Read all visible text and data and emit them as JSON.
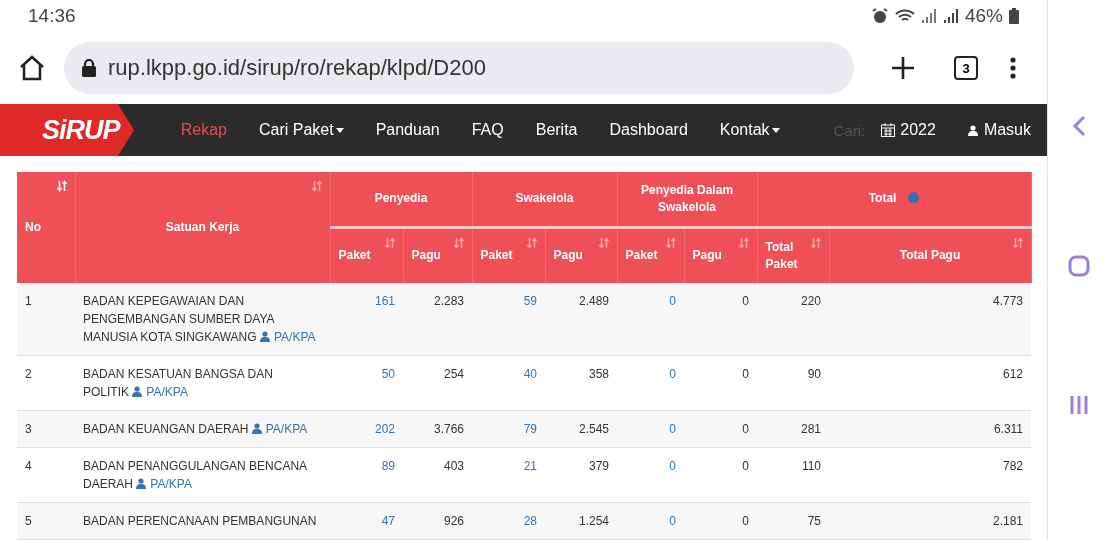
{
  "status_bar": {
    "time": "14:36",
    "battery": "46%"
  },
  "browser": {
    "url": "rup.lkpp.go.id/sirup/ro/rekap/klpd/D200",
    "tab_count": "3"
  },
  "navbar": {
    "logo": "SiRUP",
    "items": [
      {
        "label": "Rekap",
        "selected": true,
        "dropdown": false
      },
      {
        "label": "Cari Paket",
        "selected": false,
        "dropdown": true
      },
      {
        "label": "Panduan",
        "selected": false,
        "dropdown": false
      },
      {
        "label": "FAQ",
        "selected": false,
        "dropdown": false
      },
      {
        "label": "Berita",
        "selected": false,
        "dropdown": false
      },
      {
        "label": "Dashboard",
        "selected": false,
        "dropdown": false
      },
      {
        "label": "Kontak",
        "selected": false,
        "dropdown": true
      }
    ],
    "ghost_label": "Cari:",
    "year": "2022",
    "login": "Masuk"
  },
  "table": {
    "no_header": {
      "label": "No",
      "sorted": true
    },
    "unit_header": {
      "label": "Satuan Kerja",
      "sorted": false
    },
    "groups": [
      {
        "label": "Penyedia",
        "help": false
      },
      {
        "label": "Swakelola",
        "help": false
      },
      {
        "label": "Penyedia Dalam Swakelola",
        "help": false
      },
      {
        "label": "Total",
        "help": true
      }
    ],
    "columns": [
      {
        "label": "Paket",
        "sorted": false
      },
      {
        "label": "Pagu",
        "sorted": false
      },
      {
        "label": "Paket",
        "sorted": false
      },
      {
        "label": "Pagu",
        "sorted": false
      },
      {
        "label": "Paket",
        "sorted": false
      },
      {
        "label": "Pagu",
        "sorted": false
      },
      {
        "label": "Total Paket",
        "sorted": false
      },
      {
        "label": "Total Pagu",
        "sorted": false
      }
    ],
    "rows": [
      {
        "no": "1",
        "unit": "BADAN KEPEGAWAIAN DAN PENGEMBANGAN SUMBER DAYA MANUSIA KOTA SINGKAWANG",
        "role": "PA/KPA",
        "cells": [
          "161",
          "2.283",
          "59",
          "2.489",
          "0",
          "0",
          "220",
          "4.773"
        ]
      },
      {
        "no": "2",
        "unit": "BADAN KESATUAN BANGSA DAN POLITIK",
        "role": "PA/KPA",
        "cells": [
          "50",
          "254",
          "40",
          "358",
          "0",
          "0",
          "90",
          "612"
        ]
      },
      {
        "no": "3",
        "unit": "BADAN KEUANGAN DAERAH",
        "role": "PA/KPA",
        "cells": [
          "202",
          "3.766",
          "79",
          "2.545",
          "0",
          "0",
          "281",
          "6.311"
        ]
      },
      {
        "no": "4",
        "unit": "BADAN PENANGGULANGAN BENCANA DAERAH",
        "role": "PA/KPA",
        "cells": [
          "89",
          "403",
          "21",
          "379",
          "0",
          "0",
          "110",
          "782"
        ]
      },
      {
        "no": "5",
        "unit": "BADAN PERENCANAAN PEMBANGUNAN",
        "cells": [
          "47",
          "926",
          "28",
          "1.254",
          "0",
          "0",
          "75",
          "2.181"
        ]
      }
    ]
  }
}
